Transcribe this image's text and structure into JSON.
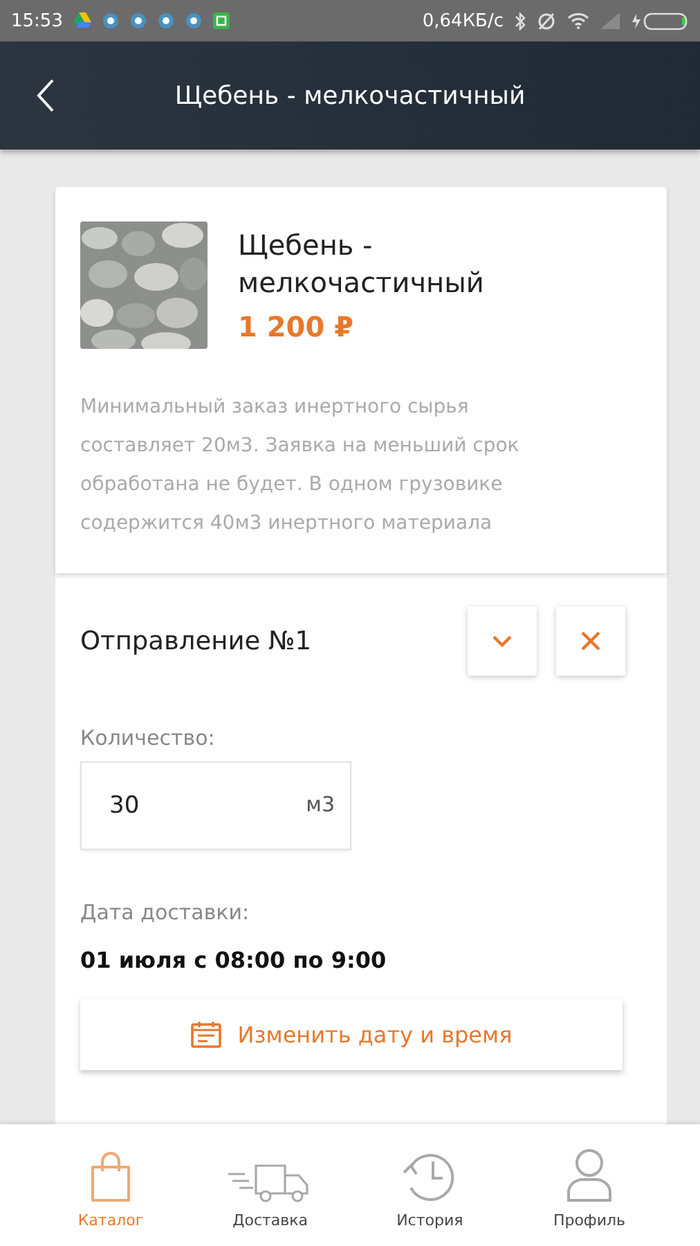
{
  "status_bar": {
    "time": "15:53",
    "speed": "0,64КБ/с"
  },
  "header": {
    "title": "Щебень - мелкочастичный"
  },
  "product": {
    "name": "Щебень - мелкочастичный",
    "price": "1 200 ₽",
    "description": "Минимальный заказ инертного сырья составляет 20м3. Заявка на меньший срок обработана не будет. В одном грузовике содержится 40м3 инертного материала"
  },
  "shipment": {
    "title": "Отправление №1",
    "quantity_label": "Количество:",
    "quantity": {
      "value": "30",
      "unit": "м3"
    },
    "date_label": "Дата доставки:",
    "date": "01 июля с 08:00 по 9:00",
    "change_button": "Изменить дату и время"
  },
  "bottom_nav": [
    {
      "kind": "bag",
      "label": "Каталог",
      "selected": true
    },
    {
      "kind": "truck",
      "label": "Доставка",
      "selected": false
    },
    {
      "kind": "history",
      "label": "История",
      "selected": false
    },
    {
      "kind": "person",
      "label": "Профиль",
      "selected": false
    }
  ]
}
